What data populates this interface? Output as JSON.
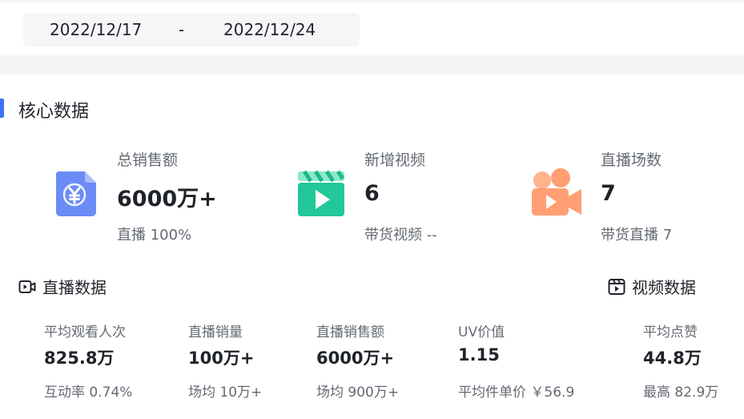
{
  "date_range": {
    "start": "2022/12/17",
    "separator": "-",
    "end": "2022/12/24"
  },
  "core": {
    "title": "核心数据",
    "kpis": [
      {
        "label": "总销售额",
        "value": "6000万+",
        "sub": "直播 100%",
        "icon": "yuan-document-icon",
        "color": "#6b8cf5"
      },
      {
        "label": "新增视频",
        "value": "6",
        "sub": "带货视频 --",
        "icon": "clapperboard-play-icon",
        "color": "#22c79a"
      },
      {
        "label": "直播场数",
        "value": "7",
        "sub": "带货直播 7",
        "icon": "video-camera-icon",
        "color": "#ff9f73"
      }
    ]
  },
  "live": {
    "title": "直播数据",
    "metrics": [
      {
        "label": "平均观看人次",
        "value": "825.8万",
        "sub": "互动率 0.74%"
      },
      {
        "label": "直播销量",
        "value": "100万+",
        "sub": "场均 10万+"
      },
      {
        "label": "直播销售额",
        "value": "6000万+",
        "sub": "场均 900万+"
      },
      {
        "label": "UV价值",
        "value": "1.15",
        "sub": "平均件单价 ￥56.9"
      }
    ]
  },
  "video": {
    "title": "视频数据",
    "metrics": [
      {
        "label": "平均点赞",
        "value": "44.8万",
        "sub": "最高 82.9万"
      }
    ]
  }
}
